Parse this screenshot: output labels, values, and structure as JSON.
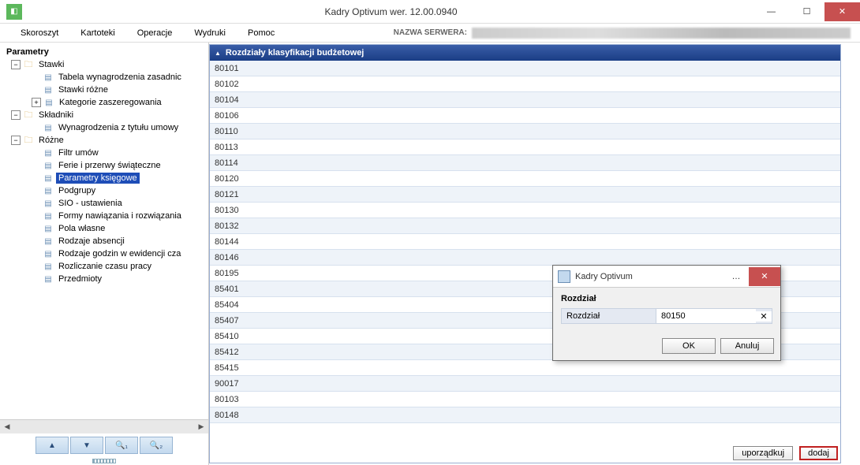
{
  "window": {
    "title": "Kadry Optivum wer. 12.00.0940"
  },
  "menu": {
    "items": [
      "Skoroszyt",
      "Kartoteki",
      "Operacje",
      "Wydruki",
      "Pomoc"
    ],
    "server_label": "NAZWA SERWERA:"
  },
  "sidebar": {
    "title": "Parametry",
    "groups": [
      {
        "label": "Stawki",
        "children": [
          "Tabela wynagrodzenia zasadnic",
          "Stawki różne",
          "Kategorie zaszeregowania"
        ]
      },
      {
        "label": "Składniki",
        "children": [
          "Wynagrodzenia z tytułu umowy"
        ]
      },
      {
        "label": "Różne",
        "children": [
          "Filtr umów",
          "Ferie i przerwy świąteczne",
          "Parametry księgowe",
          "Podgrupy",
          "SIO - ustawienia",
          "Formy nawiązania i rozwiązania",
          "Pola własne",
          "Rodzaje absencji",
          "Rodzaje godzin w ewidencji cza",
          "Rozliczanie czasu pracy",
          "Przedmioty"
        ]
      }
    ],
    "selected": "Parametry księgowe"
  },
  "grid": {
    "header": "Rozdziały klasyfikacji budżetowej",
    "rows": [
      "80101",
      "80102",
      "80104",
      "80106",
      "80110",
      "80113",
      "80114",
      "80120",
      "80121",
      "80130",
      "80132",
      "80144",
      "80146",
      "80195",
      "85401",
      "85404",
      "85407",
      "85410",
      "85412",
      "85415",
      "90017",
      "80103",
      "80148"
    ]
  },
  "footer": {
    "sort_label": "uporządkuj",
    "add_label": "dodaj"
  },
  "dialog": {
    "title": "Kadry Optivum",
    "section": "Rozdział",
    "field_label": "Rozdział",
    "field_value": "80150",
    "ok_label": "OK",
    "cancel_label": "Anuluj"
  }
}
